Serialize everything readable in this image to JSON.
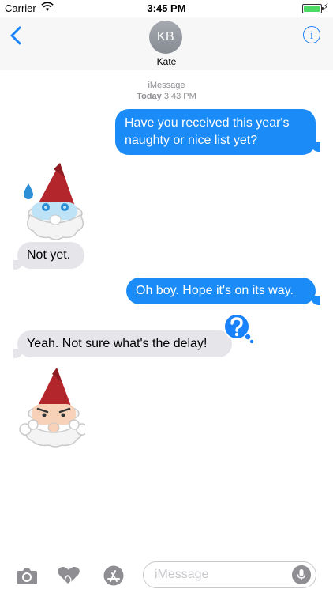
{
  "status_bar": {
    "carrier": "Carrier",
    "time": "3:45 PM"
  },
  "header": {
    "avatar_initials": "KB",
    "contact_name": "Kate",
    "back_icon": "chevron-left-icon",
    "info_icon": "info-icon"
  },
  "conversation": {
    "service_label": "iMessage",
    "date_label": "Today",
    "time_label": "3:43 PM",
    "messages": [
      {
        "direction": "outgoing",
        "text": "Have you received this year's naughty or nice list yet?"
      },
      {
        "direction": "incoming",
        "type": "sticker",
        "sticker": "worried-gnome-sticker"
      },
      {
        "direction": "incoming",
        "text": "Not yet."
      },
      {
        "direction": "outgoing",
        "text": "Oh boy. Hope it's on its way."
      },
      {
        "direction": "incoming",
        "text": "Yeah. Not sure what's the delay!",
        "reaction": "question-mark-icon"
      },
      {
        "direction": "incoming",
        "type": "sticker",
        "sticker": "angry-gnome-sticker"
      }
    ]
  },
  "input_bar": {
    "placeholder": "iMessage"
  },
  "colors": {
    "accent": "#1a82fb",
    "outgoing_bubble": "#1a8bf7",
    "incoming_bubble": "#e5e5ea",
    "battery": "#4cd964"
  }
}
